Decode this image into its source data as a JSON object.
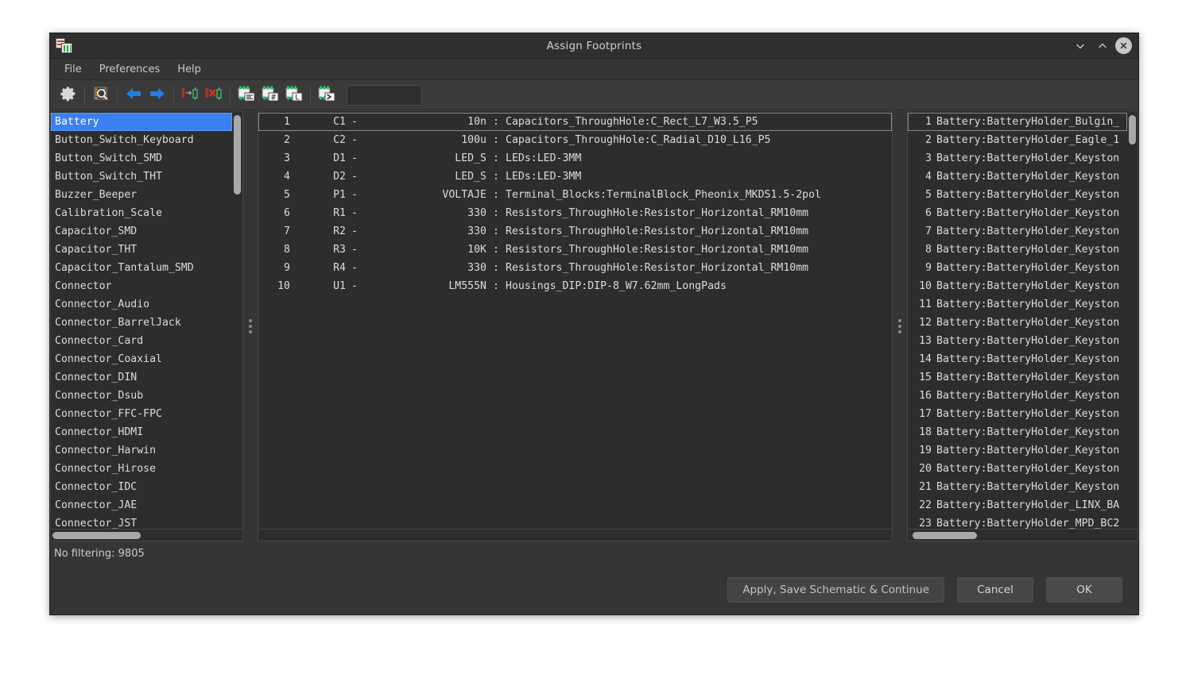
{
  "window": {
    "title": "Assign Footprints",
    "app_icon": "kicad-footprint-assign-icon",
    "controls": {
      "minimize": "minimize-icon",
      "maximize": "maximize-icon",
      "close": "close-icon"
    }
  },
  "menubar": {
    "items": [
      "File",
      "Preferences",
      "Help"
    ]
  },
  "toolbar": {
    "buttons": [
      {
        "name": "configure-paths-button",
        "icon": "gear-icon"
      },
      {
        "name": "manage-footprint-libraries-button",
        "icon": "footprint-library-view-icon"
      },
      {
        "name": "previous-unlinked-symbol-button",
        "icon": "arrow-left-icon"
      },
      {
        "name": "next-unlinked-symbol-button",
        "icon": "arrow-right-icon"
      },
      {
        "name": "assign-footprint-button",
        "icon": "assign-footprint-icon"
      },
      {
        "name": "delete-association-button",
        "icon": "delete-association-icon"
      },
      {
        "name": "filter-by-footprint-filters-button",
        "icon": "filter-footprint-list-icon"
      },
      {
        "name": "filter-by-pin-count-button",
        "icon": "filter-pin-count-icon"
      },
      {
        "name": "filter-by-library-button",
        "icon": "filter-library-icon"
      },
      {
        "name": "filter-by-text-button",
        "icon": "filter-text-icon"
      }
    ],
    "filter_input": {
      "value": "",
      "placeholder": ""
    }
  },
  "libraries_panel": {
    "name": "footprint-libraries-list",
    "selected_index": 0,
    "scroll": {
      "vertical_thumb_top_pct": 1,
      "vertical_thumb_height_pct": 19,
      "horizontal_thumb_left_pct": 1,
      "horizontal_thumb_width_pct": 46
    },
    "items": [
      "Battery",
      "Button_Switch_Keyboard",
      "Button_Switch_SMD",
      "Button_Switch_THT",
      "Buzzer_Beeper",
      "Calibration_Scale",
      "Capacitor_SMD",
      "Capacitor_THT",
      "Capacitor_Tantalum_SMD",
      "Connector",
      "Connector_Audio",
      "Connector_BarrelJack",
      "Connector_Card",
      "Connector_Coaxial",
      "Connector_DIN",
      "Connector_Dsub",
      "Connector_FFC-FPC",
      "Connector_HDMI",
      "Connector_Harwin",
      "Connector_Hirose",
      "Connector_IDC",
      "Connector_JAE",
      "Connector_JST"
    ]
  },
  "symbols_panel": {
    "name": "symbol-footprint-association-list",
    "focused_index": 0,
    "rows": [
      {
        "index": "1",
        "ref": "C1",
        "dash": "-",
        "value": "10n",
        "colon": ":",
        "footprint": "Capacitors_ThroughHole:C_Rect_L7_W3.5_P5"
      },
      {
        "index": "2",
        "ref": "C2",
        "dash": "-",
        "value": "100u",
        "colon": ":",
        "footprint": "Capacitors_ThroughHole:C_Radial_D10_L16_P5"
      },
      {
        "index": "3",
        "ref": "D1",
        "dash": "-",
        "value": "LED_S",
        "colon": ":",
        "footprint": "LEDs:LED-3MM"
      },
      {
        "index": "4",
        "ref": "D2",
        "dash": "-",
        "value": "LED_S",
        "colon": ":",
        "footprint": "LEDs:LED-3MM"
      },
      {
        "index": "5",
        "ref": "P1",
        "dash": "-",
        "value": "VOLTAJE",
        "colon": ":",
        "footprint": "Terminal_Blocks:TerminalBlock_Pheonix_MKDS1.5-2pol"
      },
      {
        "index": "6",
        "ref": "R1",
        "dash": "-",
        "value": "330",
        "colon": ":",
        "footprint": "Resistors_ThroughHole:Resistor_Horizontal_RM10mm"
      },
      {
        "index": "7",
        "ref": "R2",
        "dash": "-",
        "value": "330",
        "colon": ":",
        "footprint": "Resistors_ThroughHole:Resistor_Horizontal_RM10mm"
      },
      {
        "index": "8",
        "ref": "R3",
        "dash": "-",
        "value": "10K",
        "colon": ":",
        "footprint": "Resistors_ThroughHole:Resistor_Horizontal_RM10mm"
      },
      {
        "index": "9",
        "ref": "R4",
        "dash": "-",
        "value": "330",
        "colon": ":",
        "footprint": "Resistors_ThroughHole:Resistor_Horizontal_RM10mm"
      },
      {
        "index": "10",
        "ref": "U1",
        "dash": "-",
        "value": "LM555N",
        "colon": ":",
        "footprint": "Housings_DIP:DIP-8_W7.62mm_LongPads"
      }
    ]
  },
  "footprints_panel": {
    "name": "footprint-list",
    "focused_index": 0,
    "scroll": {
      "vertical_thumb_top_pct": 1,
      "vertical_thumb_height_pct": 7,
      "horizontal_thumb_left_pct": 2,
      "horizontal_thumb_width_pct": 28
    },
    "rows": [
      {
        "index": "1",
        "text": "Battery:BatteryHolder_Bulgin_"
      },
      {
        "index": "2",
        "text": "Battery:BatteryHolder_Eagle_1"
      },
      {
        "index": "3",
        "text": "Battery:BatteryHolder_Keyston"
      },
      {
        "index": "4",
        "text": "Battery:BatteryHolder_Keyston"
      },
      {
        "index": "5",
        "text": "Battery:BatteryHolder_Keyston"
      },
      {
        "index": "6",
        "text": "Battery:BatteryHolder_Keyston"
      },
      {
        "index": "7",
        "text": "Battery:BatteryHolder_Keyston"
      },
      {
        "index": "8",
        "text": "Battery:BatteryHolder_Keyston"
      },
      {
        "index": "9",
        "text": "Battery:BatteryHolder_Keyston"
      },
      {
        "index": "10",
        "text": "Battery:BatteryHolder_Keyston"
      },
      {
        "index": "11",
        "text": "Battery:BatteryHolder_Keyston"
      },
      {
        "index": "12",
        "text": "Battery:BatteryHolder_Keyston"
      },
      {
        "index": "13",
        "text": "Battery:BatteryHolder_Keyston"
      },
      {
        "index": "14",
        "text": "Battery:BatteryHolder_Keyston"
      },
      {
        "index": "15",
        "text": "Battery:BatteryHolder_Keyston"
      },
      {
        "index": "16",
        "text": "Battery:BatteryHolder_Keyston"
      },
      {
        "index": "17",
        "text": "Battery:BatteryHolder_Keyston"
      },
      {
        "index": "18",
        "text": "Battery:BatteryHolder_Keyston"
      },
      {
        "index": "19",
        "text": "Battery:BatteryHolder_Keyston"
      },
      {
        "index": "20",
        "text": "Battery:BatteryHolder_Keyston"
      },
      {
        "index": "21",
        "text": "Battery:BatteryHolder_Keyston"
      },
      {
        "index": "22",
        "text": "Battery:BatteryHolder_LINX_BA"
      },
      {
        "index": "23",
        "text": "Battery:BatteryHolder_MPD_BC2"
      }
    ]
  },
  "status": {
    "text": "No filtering: 9805"
  },
  "footer": {
    "apply_label": "Apply, Save Schematic & Continue",
    "cancel_label": "Cancel",
    "ok_label": "OK"
  },
  "colors": {
    "window_bg": "#353535",
    "list_bg": "#2d2d2d",
    "selection": "#3a80f0",
    "text": "#dcdcdc",
    "titlebar": "#2f2f2f",
    "toolbar": "#3a3a3a"
  }
}
